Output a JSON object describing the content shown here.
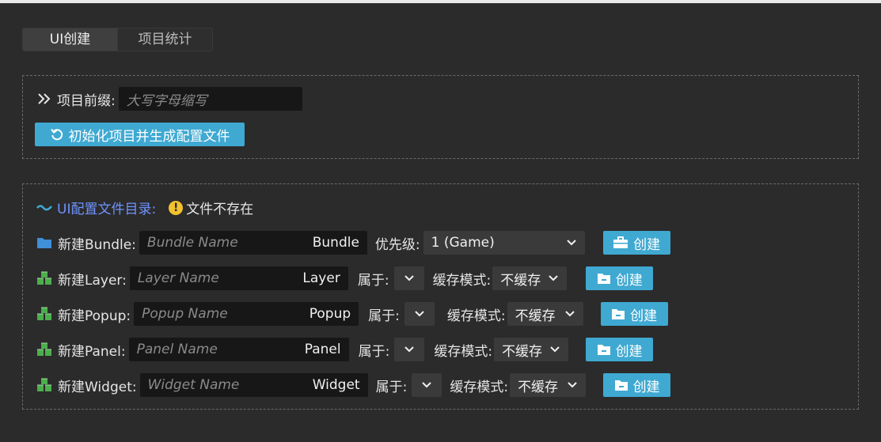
{
  "tabs": [
    {
      "label": "UI创建"
    },
    {
      "label": "项目统计"
    }
  ],
  "project": {
    "prefix_label": "项目前缀:",
    "prefix_placeholder": "大写字母缩写",
    "init_button": "初始化项目并生成配置文件"
  },
  "ui_config": {
    "dir_label": "UI配置文件目录:",
    "status": "文件不存在",
    "accent_color": "#6f93ff",
    "button_color": "#3fa9d2"
  },
  "bundle": {
    "label": "新建Bundle:",
    "placeholder": "Bundle Name",
    "suffix": "Bundle",
    "priority_label": "优先级:",
    "priority_value": "1 (Game)",
    "create": "创建"
  },
  "rows": [
    {
      "label": "新建Layer:",
      "placeholder": "Layer Name",
      "suffix": "Layer",
      "belong_label": "属于:",
      "cache_label": "缓存模式:",
      "cache_value": "不缓存",
      "create": "创建"
    },
    {
      "label": "新建Popup:",
      "placeholder": "Popup Name",
      "suffix": "Popup",
      "belong_label": "属于:",
      "cache_label": "缓存模式:",
      "cache_value": "不缓存",
      "create": "创建"
    },
    {
      "label": "新建Panel:",
      "placeholder": "Panel Name",
      "suffix": "Panel",
      "belong_label": "属于:",
      "cache_label": "缓存模式:",
      "cache_value": "不缓存",
      "create": "创建"
    },
    {
      "label": "新建Widget:",
      "placeholder": "Widget Name",
      "suffix": "Widget",
      "belong_label": "属于:",
      "cache_label": "缓存模式:",
      "cache_value": "不缓存",
      "create": "创建"
    }
  ]
}
